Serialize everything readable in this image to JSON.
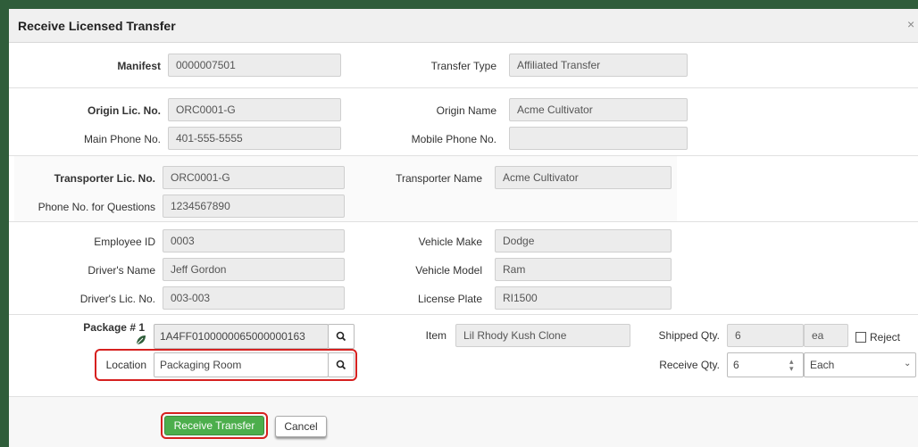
{
  "dialog": {
    "title": "Receive Licensed Transfer",
    "close": "×"
  },
  "manifest": {
    "manifest_label": "Manifest",
    "manifest_value": "0000007501",
    "type_label": "Transfer Type",
    "type_value": "Affiliated Transfer"
  },
  "origin": {
    "lic_label": "Origin Lic. No.",
    "lic_value": "ORC0001-G",
    "name_label": "Origin Name",
    "name_value": "Acme Cultivator",
    "phone_label": "Main Phone No.",
    "phone_value": "401-555-5555",
    "mobile_label": "Mobile Phone No.",
    "mobile_value": ""
  },
  "transporter": {
    "lic_label": "Transporter Lic. No.",
    "lic_value": "ORC0001-G",
    "name_label": "Transporter Name",
    "name_value": "Acme Cultivator",
    "phone_label": "Phone No. for Questions",
    "phone_value": "1234567890"
  },
  "driver": {
    "emp_label": "Employee ID",
    "emp_value": "0003",
    "name_label": "Driver's Name",
    "name_value": "Jeff Gordon",
    "lic_label": "Driver's Lic. No.",
    "lic_value": "003-003",
    "make_label": "Vehicle Make",
    "make_value": "Dodge",
    "model_label": "Vehicle Model",
    "model_value": "Ram",
    "plate_label": "License Plate",
    "plate_value": "RI1500"
  },
  "package": {
    "label": "Package # 1",
    "value": "1A4FF0100000065000000163",
    "item_label": "Item",
    "item_value": "Lil Rhody Kush Clone",
    "shipped_label": "Shipped Qty.",
    "shipped_value": "6",
    "shipped_unit": "ea",
    "reject_label": "Reject",
    "location_label": "Location",
    "location_value": "Packaging Room",
    "receive_label": "Receive Qty.",
    "receive_value": "6",
    "receive_unit": "Each"
  },
  "actions": {
    "receive": "Receive Transfer",
    "cancel": "Cancel"
  },
  "colors": {
    "accent_green": "#4cae4c",
    "highlight_red": "#d6201f"
  }
}
